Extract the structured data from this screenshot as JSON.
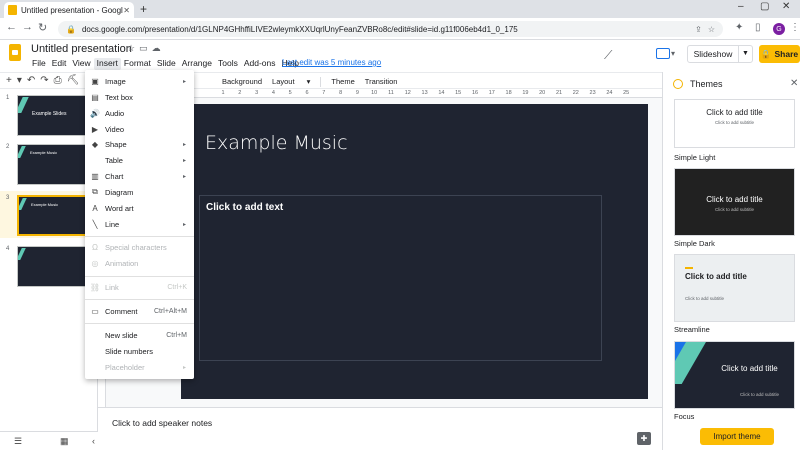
{
  "browser": {
    "tab_title": "Untitled presentation - Google S",
    "new_tab": "+",
    "url": "docs.google.com/presentation/d/1GLNP4GHhffiLIVE2wleymkXXUqrlUnyFeanZVBRo8c/edit#slide=id.g11f006eb4d1_0_175",
    "avatar_letter": "G"
  },
  "header": {
    "doc_title": "Untitled presentation",
    "last_edit": "Last edit was 5 minutes ago",
    "slideshow": "Slideshow",
    "share": "Share",
    "menus": [
      "File",
      "Edit",
      "View",
      "Insert",
      "Format",
      "Slide",
      "Arrange",
      "Tools",
      "Add-ons",
      "Help"
    ]
  },
  "toolbar": {
    "background": "Background",
    "layout": "Layout",
    "theme": "Theme",
    "transition": "Transition"
  },
  "ruler": [
    "1",
    "2",
    "3",
    "4",
    "5",
    "6",
    "7",
    "8",
    "9",
    "10",
    "11",
    "12",
    "13",
    "14",
    "15",
    "16",
    "17",
    "18",
    "19",
    "20",
    "21",
    "22",
    "23",
    "24",
    "25"
  ],
  "filmstrip": {
    "slides": [
      {
        "num": "1",
        "text": "Example Slides"
      },
      {
        "num": "2",
        "text": "Example Music"
      },
      {
        "num": "3",
        "text": "Example Music"
      },
      {
        "num": "4",
        "text": ""
      }
    ]
  },
  "slide": {
    "title": "Example Music",
    "body": "Click to add text"
  },
  "notes": "Click to add speaker notes",
  "insert_menu": {
    "items": [
      {
        "label": "Image",
        "shortcut": "",
        "submenu": true,
        "disabled": false
      },
      {
        "label": "Text box",
        "shortcut": "",
        "submenu": false,
        "disabled": false
      },
      {
        "label": "Audio",
        "shortcut": "",
        "submenu": false,
        "disabled": false
      },
      {
        "label": "Video",
        "shortcut": "",
        "submenu": false,
        "disabled": false
      },
      {
        "label": "Shape",
        "shortcut": "",
        "submenu": true,
        "disabled": false
      },
      {
        "label": "Table",
        "shortcut": "",
        "submenu": true,
        "disabled": false
      },
      {
        "label": "Chart",
        "shortcut": "",
        "submenu": true,
        "disabled": false
      },
      {
        "label": "Diagram",
        "shortcut": "",
        "submenu": false,
        "disabled": false
      },
      {
        "label": "Word art",
        "shortcut": "",
        "submenu": false,
        "disabled": false
      },
      {
        "label": "Line",
        "shortcut": "",
        "submenu": true,
        "disabled": false
      },
      {
        "label": "Special characters",
        "shortcut": "",
        "submenu": false,
        "disabled": true
      },
      {
        "label": "Animation",
        "shortcut": "",
        "submenu": false,
        "disabled": true
      },
      {
        "label": "Link",
        "shortcut": "Ctrl+K",
        "submenu": false,
        "disabled": true
      },
      {
        "label": "Comment",
        "shortcut": "Ctrl+Alt+M",
        "submenu": false,
        "disabled": false
      },
      {
        "label": "New slide",
        "shortcut": "Ctrl+M",
        "submenu": false,
        "disabled": false
      },
      {
        "label": "Slide numbers",
        "shortcut": "",
        "submenu": false,
        "disabled": false
      },
      {
        "label": "Placeholder",
        "shortcut": "",
        "submenu": true,
        "disabled": true
      }
    ]
  },
  "themes": {
    "title": "Themes",
    "cards": [
      {
        "name": "Simple Light",
        "title": "Click to add title",
        "subtitle": "Click to add subtitle"
      },
      {
        "name": "Simple Dark",
        "title": "Click to add title",
        "subtitle": "Click to add subtitle"
      },
      {
        "name": "Streamline",
        "title": "Click to add title",
        "subtitle": "Click to add subtitle"
      },
      {
        "name": "Focus",
        "title": "Click to add title",
        "subtitle": "Click to add subtitle"
      }
    ],
    "import": "Import theme"
  },
  "colors": {
    "accent_yellow": "#fbbc04",
    "slide_bg": "#1f2431",
    "teal": "#5fc9b4",
    "link_blue": "#1a73e8"
  }
}
